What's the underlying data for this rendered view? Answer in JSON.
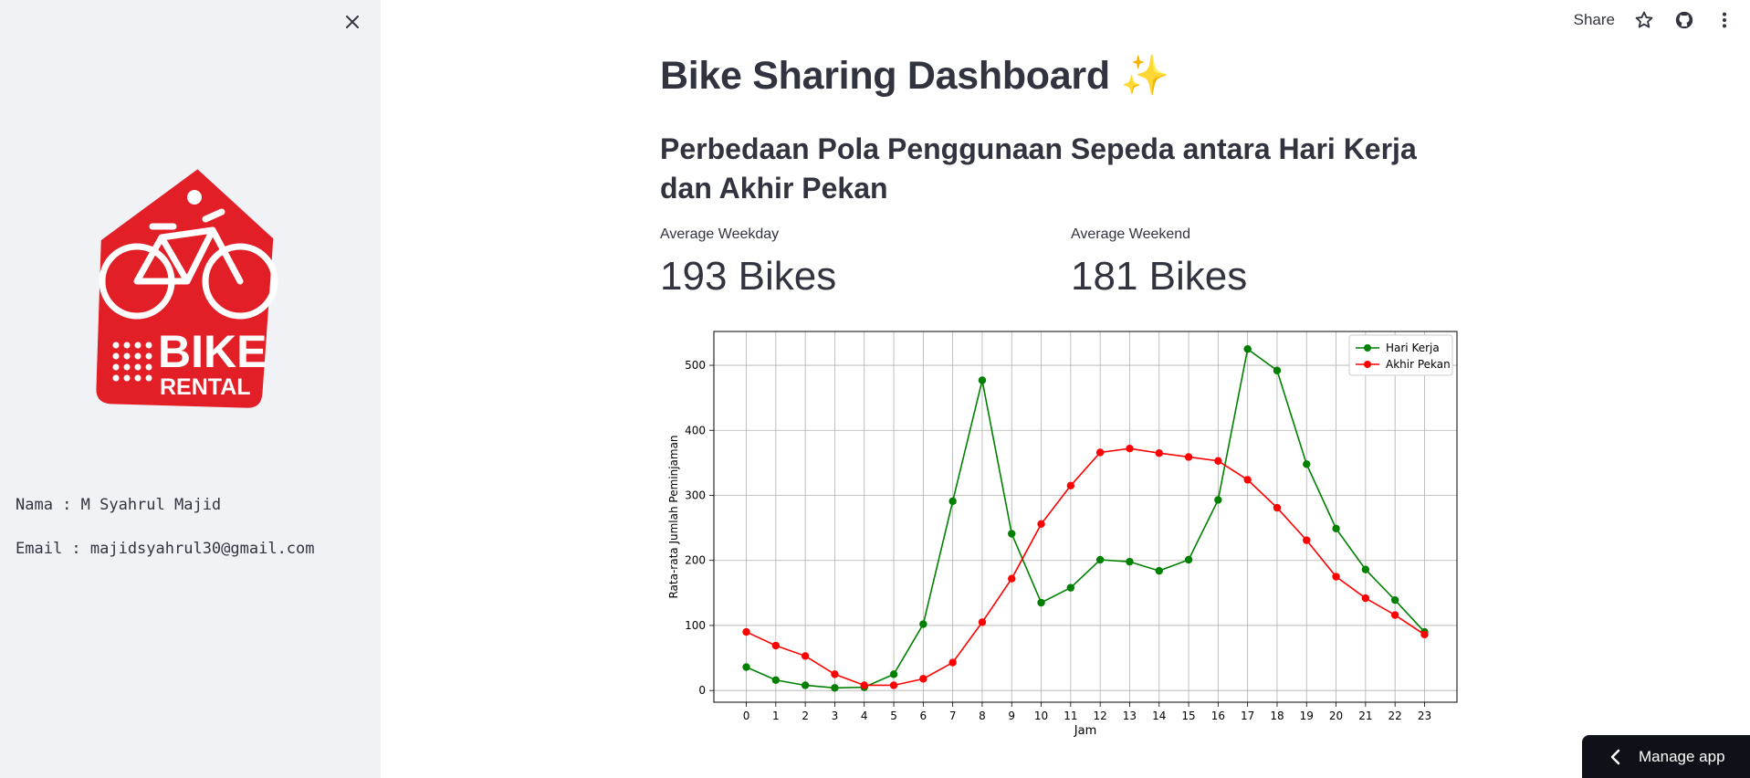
{
  "sidebar": {
    "logo": {
      "line1": "BIKE",
      "line2": "RENTAL"
    },
    "name_line": "Nama : M Syahrul Majid",
    "email_line": "Email : majidsyahrul30@gmail.com",
    "close_icon": "close-icon"
  },
  "header": {
    "share_label": "Share",
    "icons": [
      "star-icon",
      "github-icon",
      "more-vertical-icon"
    ]
  },
  "main": {
    "title": "Bike Sharing Dashboard ✨",
    "subtitle": "Perbedaan Pola Penggunaan Sepeda antara Hari Kerja dan Akhir Pekan",
    "metrics": [
      {
        "label": "Average Weekday",
        "value": "193 Bikes"
      },
      {
        "label": "Average Weekend",
        "value": "181 Bikes"
      }
    ]
  },
  "manage_app_label": "Manage app",
  "colors": {
    "sidebar_bg": "#f0f2f6",
    "logo_red": "#e21f26",
    "series_weekday": "#008000",
    "series_weekend": "#ff0000"
  },
  "chart_data": {
    "type": "line",
    "xlabel": "Jam",
    "ylabel": "Rata-rata Jumlah Peminjaman",
    "x": [
      0,
      1,
      2,
      3,
      4,
      5,
      6,
      7,
      8,
      9,
      10,
      11,
      12,
      13,
      14,
      15,
      16,
      17,
      18,
      19,
      20,
      21,
      22,
      23
    ],
    "ylim": [
      -18,
      552
    ],
    "yticks": [
      0,
      100,
      200,
      300,
      400,
      500
    ],
    "grid": true,
    "legend": "top-right",
    "series": [
      {
        "name": "Hari Kerja",
        "color": "#008000",
        "values": [
          36,
          16,
          8,
          4,
          5,
          25,
          102,
          291,
          477,
          241,
          135,
          158,
          201,
          198,
          184,
          201,
          293,
          525,
          492,
          348,
          249,
          186,
          139,
          90
        ]
      },
      {
        "name": "Akhir Pekan",
        "color": "#ff0000",
        "values": [
          90,
          69,
          53,
          25,
          8,
          8,
          18,
          43,
          105,
          172,
          256,
          315,
          366,
          372,
          365,
          359,
          353,
          324,
          281,
          231,
          175,
          142,
          116,
          86
        ]
      }
    ]
  }
}
